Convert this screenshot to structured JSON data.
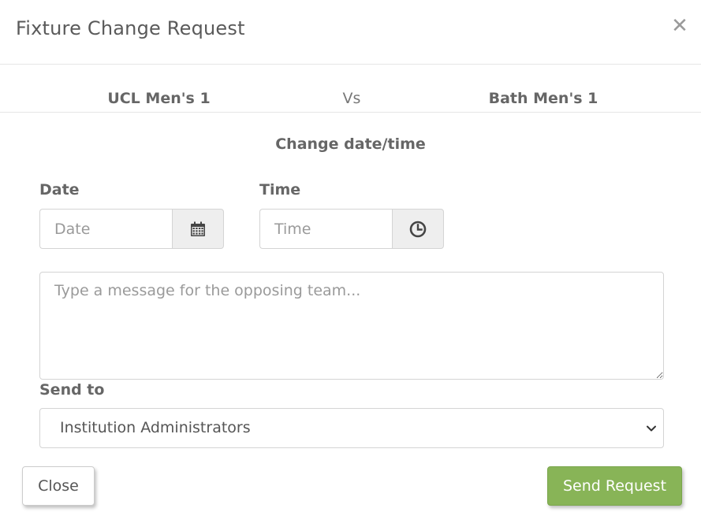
{
  "modal": {
    "title": "Fixture Change Request",
    "close_icon": "close-icon"
  },
  "fixture": {
    "home_team": "UCL Men's 1",
    "vs": "Vs",
    "away_team": "Bath Men's 1"
  },
  "section_title": "Change date/time",
  "date_field": {
    "label": "Date",
    "placeholder": "Date",
    "value": "",
    "addon_icon": "calendar-icon"
  },
  "time_field": {
    "label": "Time",
    "placeholder": "Time",
    "value": "",
    "addon_icon": "clock-icon"
  },
  "message": {
    "placeholder": "Type a message for the opposing team...",
    "value": ""
  },
  "send_to": {
    "label": "Send to",
    "selected": "Institution Administrators",
    "caret_icon": "chevron-down-icon"
  },
  "footer": {
    "close_label": "Close",
    "send_label": "Send Request"
  },
  "colors": {
    "primary_button": "#88b457",
    "addon_background": "#eeeeee",
    "border": "#d4d4d4"
  }
}
